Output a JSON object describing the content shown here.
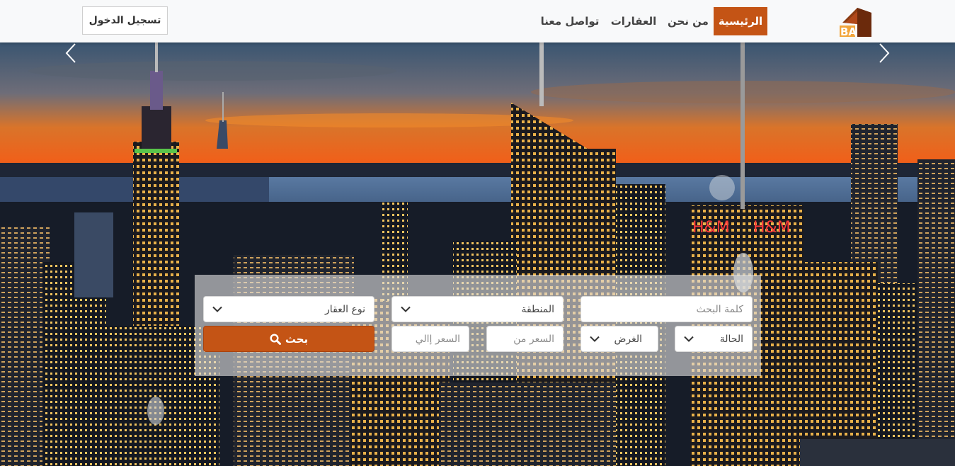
{
  "nav": {
    "login_label": "تسجيل الدخول",
    "items": [
      {
        "label": "الرئيسية",
        "active": true
      },
      {
        "label": "من نحن",
        "active": false
      },
      {
        "label": "العقارات",
        "active": false
      },
      {
        "label": "تواصل معنا",
        "active": false
      }
    ],
    "logo_icon": "brand-logo-icon"
  },
  "hero": {
    "image_icon": "city-skyline-image",
    "prev_icon": "chevron-left-icon",
    "next_icon": "chevron-right-icon"
  },
  "search": {
    "keyword_placeholder": "كلمة البحث",
    "region_value": "المنطقة",
    "property_type_value": "نوع العقار",
    "status_value": "الحالة",
    "purpose_value": "الغرض",
    "price_from_placeholder": "السعر من",
    "price_to_placeholder": "السعر إالي",
    "button_label": "بحث",
    "button_icon": "search-icon"
  },
  "colors": {
    "accent": "#c45415",
    "navbar_bg": "#f8f9fa"
  }
}
